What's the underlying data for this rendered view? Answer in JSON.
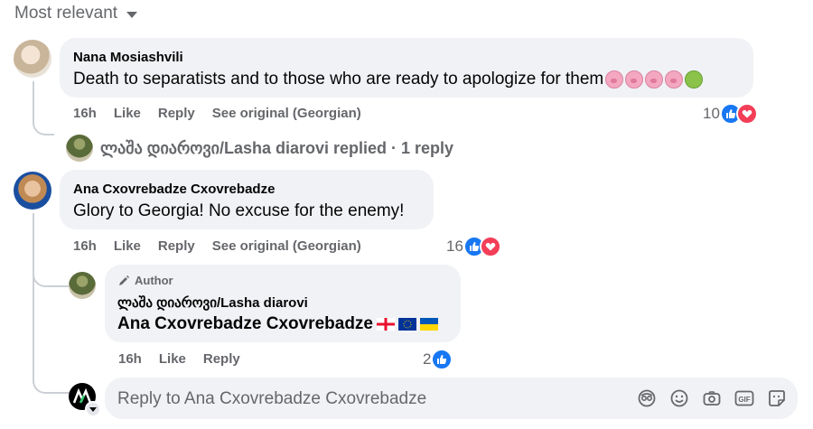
{
  "sort": {
    "label": "Most relevant"
  },
  "comments": [
    {
      "author": "Nana Mosiashvili",
      "text": "Death to separatists and to those who are ready to apologize for them",
      "time": "16h",
      "like_label": "Like",
      "reply_label": "Reply",
      "see_original": "See original (Georgian)",
      "reaction_count": "10",
      "replied_summary": "ლაშა დიაროვი/Lasha diarovi replied · 1 reply"
    },
    {
      "author": "Ana Cxovrebadze Cxovrebadze",
      "text": "Glory to Georgia! No excuse for the enemy!",
      "time": "16h",
      "like_label": "Like",
      "reply_label": "Reply",
      "see_original": "See original (Georgian)",
      "reaction_count": "16"
    }
  ],
  "reply": {
    "badge": "Author",
    "author": "ლაშა დიაროვი/Lasha diarovi",
    "text": "Ana Cxovrebadze Cxovrebadze",
    "time": "16h",
    "like_label": "Like",
    "reply_label": "Reply",
    "reaction_count": "2"
  },
  "composer": {
    "placeholder": "Reply to Ana Cxovrebadze Cxovrebadze",
    "tools": [
      "avatar-sticker-icon",
      "emoji-icon",
      "camera-icon",
      "gif-icon",
      "sticker-icon"
    ]
  },
  "colors": {
    "like": "#1877f2",
    "love": "#f33e58",
    "bubble": "#f0f2f5",
    "meta": "#65676b"
  }
}
